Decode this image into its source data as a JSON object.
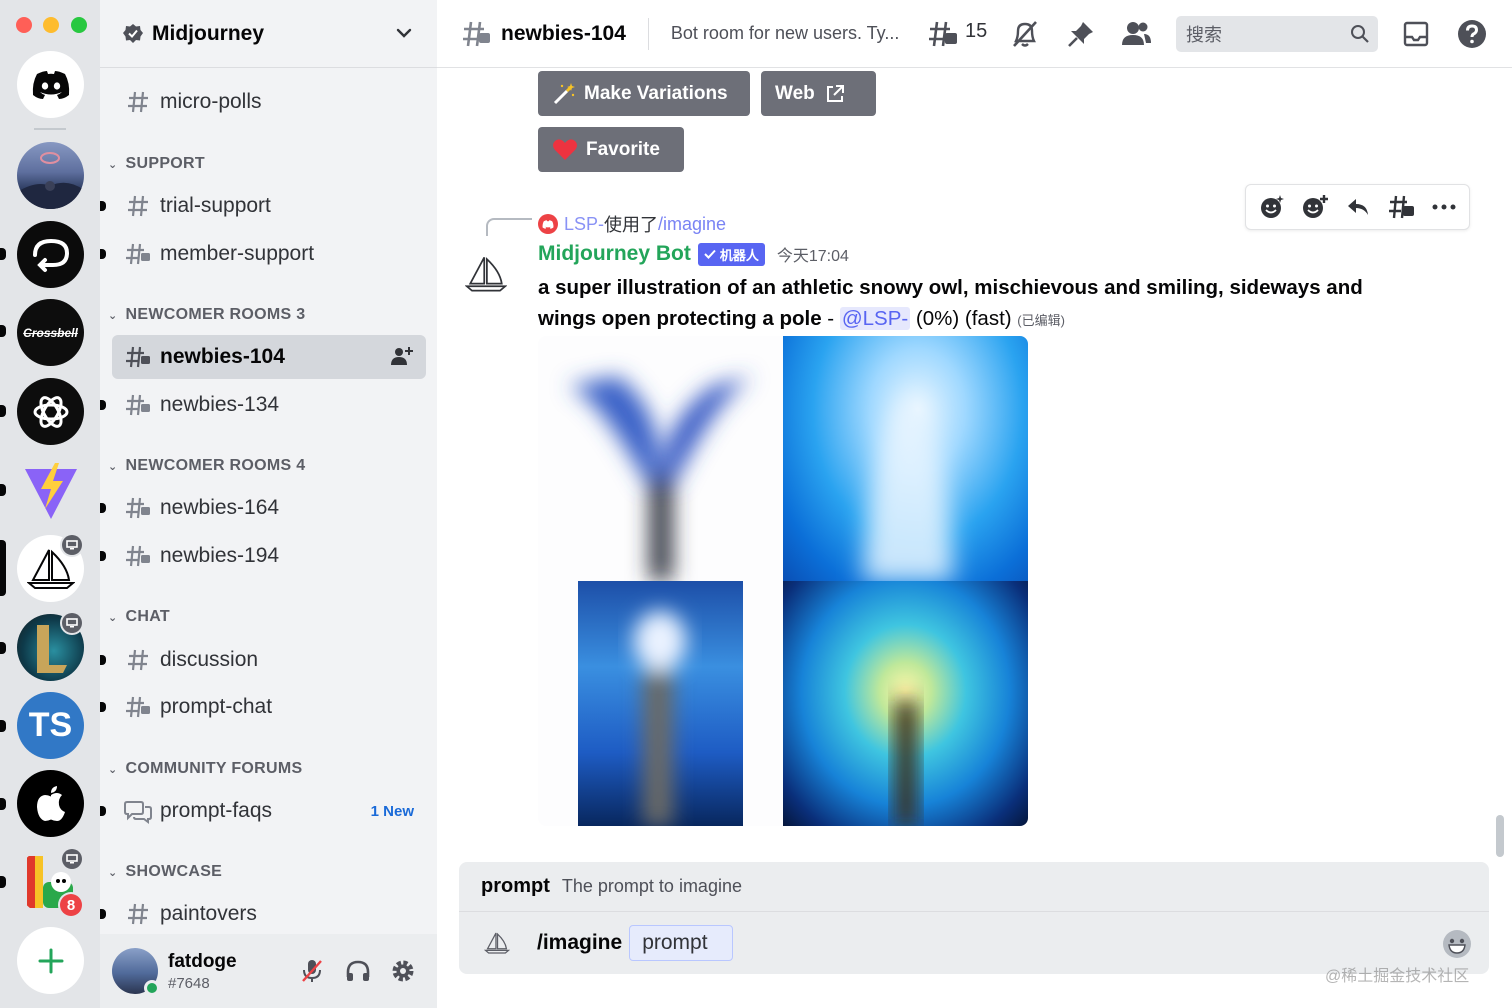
{
  "guild": {
    "name": "Midjourney"
  },
  "sidebar": {
    "channels_top": [
      {
        "label": "micro-polls"
      }
    ],
    "categories": [
      {
        "name": "SUPPORT",
        "channels": [
          {
            "label": "trial-support"
          },
          {
            "label": "member-support"
          }
        ]
      },
      {
        "name": "NEWCOMER ROOMS 3",
        "channels": [
          {
            "label": "newbies-104"
          },
          {
            "label": "newbies-134"
          }
        ]
      },
      {
        "name": "NEWCOMER ROOMS 4",
        "channels": [
          {
            "label": "newbies-164"
          },
          {
            "label": "newbies-194"
          }
        ]
      },
      {
        "name": "CHAT",
        "channels": [
          {
            "label": "discussion"
          },
          {
            "label": "prompt-chat"
          }
        ]
      },
      {
        "name": "COMMUNITY FORUMS",
        "channels": [
          {
            "label": "prompt-faqs",
            "tag": "1 New"
          }
        ]
      },
      {
        "name": "SHOWCASE",
        "channels": [
          {
            "label": "paintovers"
          }
        ]
      }
    ]
  },
  "servers": {
    "ts_label": "TS",
    "crossbell_label": "Crossbell",
    "mention_count": "8"
  },
  "user": {
    "name": "fatdoge",
    "tag": "#7648"
  },
  "topbar": {
    "channel": "newbies-104",
    "topic": "Bot room for new users. Ty...",
    "thread_count": "15",
    "search_placeholder": "搜索"
  },
  "message": {
    "buttons": {
      "make_variations": "Make Variations",
      "web": "Web",
      "favorite": "Favorite"
    },
    "reply": {
      "user": "LSP-",
      "used": "使用了",
      "command": "/imagine"
    },
    "author": "Midjourney Bot",
    "bot_badge": "机器人",
    "time": "今天17:04",
    "prompt_text": "a super illustration of an athletic snowy owl, mischievous and smiling, sideways and wings open protecting a pole",
    "separator": " - ",
    "mention": "@LSP-",
    "suffix": " (0%) (fast) ",
    "edited": "(已编辑)"
  },
  "composer": {
    "option_name": "prompt",
    "option_desc": "The prompt to imagine",
    "command": "/imagine",
    "param_label": "prompt"
  },
  "watermark": "@稀土掘金技术社区",
  "colors": {
    "brand": "#5865f2",
    "bot_green": "#23a55a",
    "button_grey": "#6d6f78",
    "rail_bg": "#e3e5e8",
    "sidebar_bg": "#f2f3f5"
  }
}
